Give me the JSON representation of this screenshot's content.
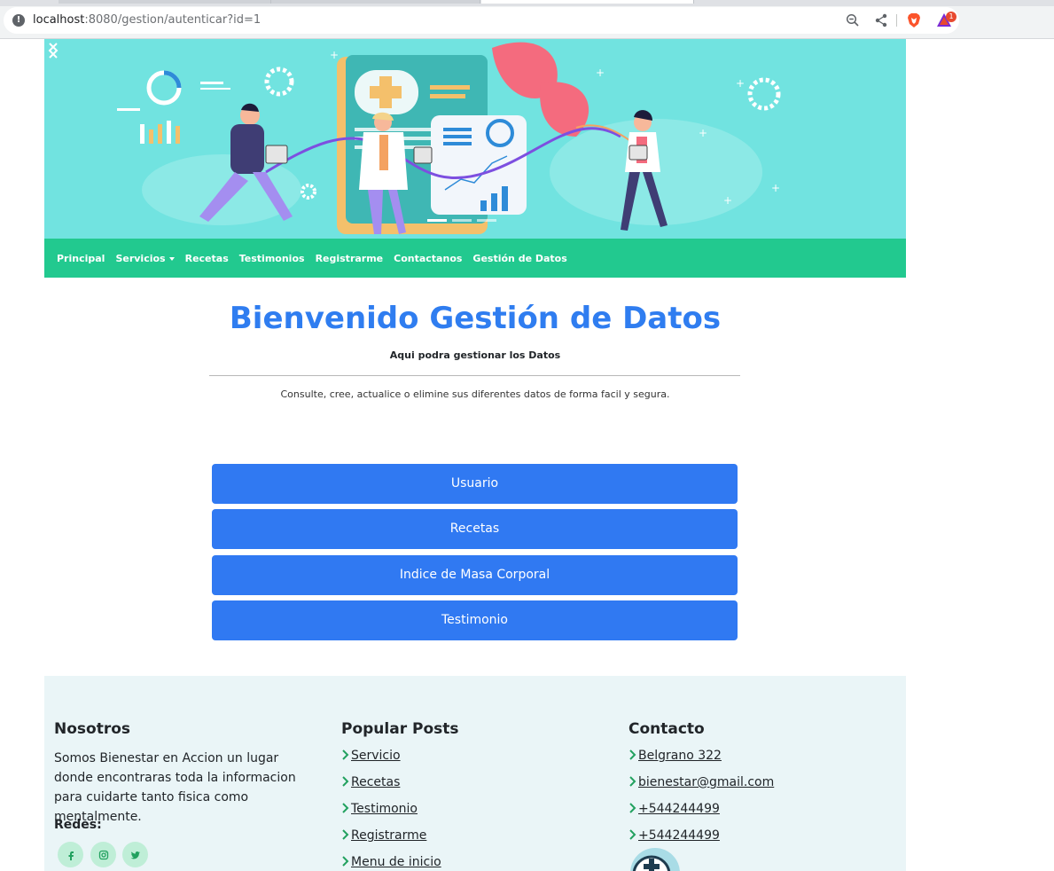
{
  "browser": {
    "url_host": "localhost",
    "url_rest": ":8080/gestion/autenticar?id=1",
    "rewards_badge": "1"
  },
  "navbar": {
    "items": [
      {
        "label": "Principal"
      },
      {
        "label": "Servicios"
      },
      {
        "label": "Recetas"
      },
      {
        "label": "Testimonios"
      },
      {
        "label": "Registrarme"
      },
      {
        "label": "Contactanos"
      },
      {
        "label": "Gestión de Datos"
      }
    ]
  },
  "main": {
    "title": "Bienvenido Gestión de Datos",
    "lead": "Aqui podra gestionar los Datos",
    "description": "Consulte, cree, actualice o elimine sus diferentes datos de forma facil y segura.",
    "buttons": [
      {
        "label": "Usuario"
      },
      {
        "label": "Recetas"
      },
      {
        "label": "Indice de Masa Corporal"
      },
      {
        "label": "Testimonio"
      }
    ]
  },
  "footer": {
    "about": {
      "title": "Nosotros",
      "text": "Somos Bienestar en Accion un lugar donde encontraras toda la informacion para cuidarte tanto fisica como mentalmente.",
      "social_label": "Redes:",
      "social": [
        "facebook-icon",
        "instagram-icon",
        "twitter-icon"
      ]
    },
    "posts": {
      "title": "Popular Posts",
      "links": [
        "Servicio",
        "Recetas",
        "Testimonio",
        "Registrarme",
        "Menu de inicio"
      ]
    },
    "contact": {
      "title": "Contacto",
      "items": [
        "Belgrano 322",
        "bienestar@gmail.com",
        "+544244499",
        "+544244499"
      ]
    }
  },
  "colors": {
    "primary": "#3079f2",
    "navbar": "#22c98f",
    "hero_bg": "#71e3e0",
    "footer_bg": "#eaf5f7"
  }
}
